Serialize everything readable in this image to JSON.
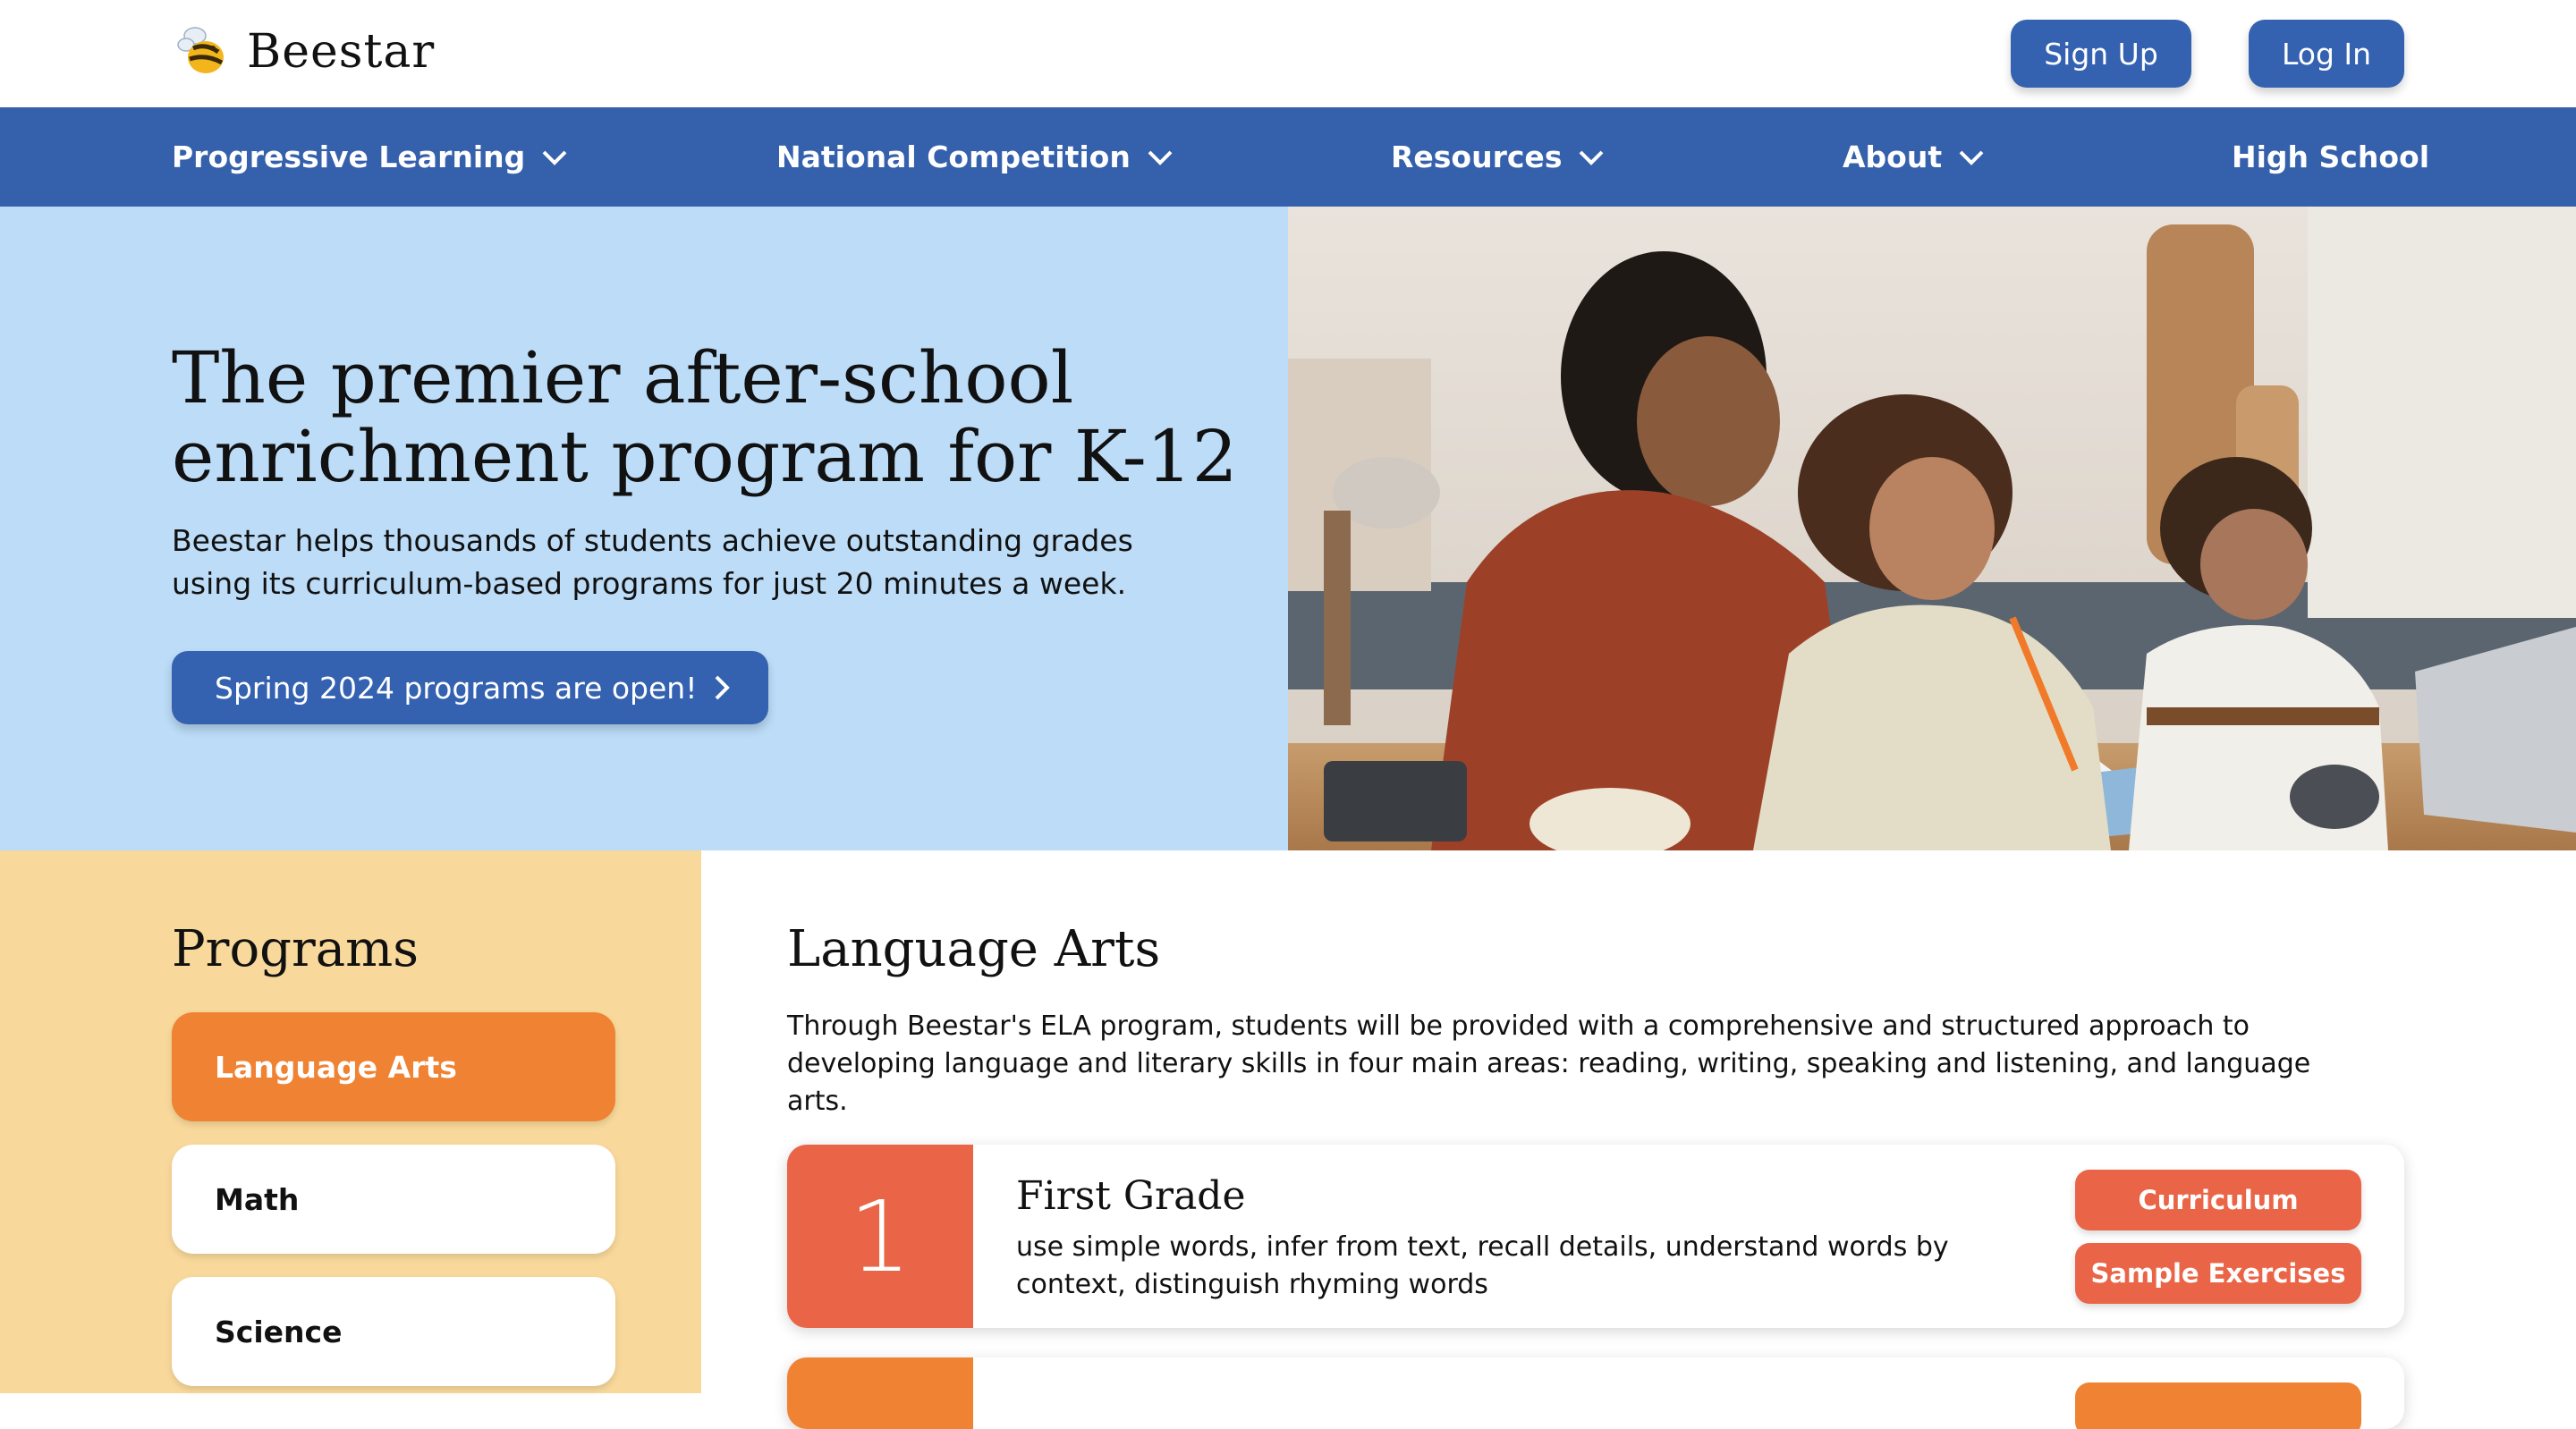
{
  "brand": {
    "name": "Beestar"
  },
  "header": {
    "signup_label": "Sign Up",
    "login_label": "Log In"
  },
  "nav": {
    "items": [
      {
        "label": "Progressive Learning",
        "has_dropdown": true
      },
      {
        "label": "National Competition",
        "has_dropdown": true
      },
      {
        "label": "Resources",
        "has_dropdown": true
      },
      {
        "label": "About",
        "has_dropdown": true
      },
      {
        "label": "High School",
        "has_dropdown": false
      }
    ]
  },
  "hero": {
    "title": "The premier after-school enrichment program for K-12",
    "subtitle": "Beestar helps thousands of students achieve outstanding grades using its curriculum-based programs for just 20 minutes a week.",
    "cta_label": "Spring 2024 programs are open!"
  },
  "programs": {
    "heading": "Programs",
    "items": [
      {
        "label": "Language Arts",
        "active": true
      },
      {
        "label": "Math",
        "active": false
      },
      {
        "label": "Science",
        "active": false
      }
    ]
  },
  "content": {
    "heading": "Language Arts",
    "description": "Through Beestar's ELA program, students will be provided with a comprehensive and structured approach to developing language and literary skills in four main areas: reading, writing, speaking and listening, and language arts.",
    "grades": [
      {
        "number": "1",
        "title": "First Grade",
        "description": "use simple words, infer from text, recall details, understand words by context, distinguish rhyming words",
        "curriculum_label": "Curriculum",
        "samples_label": "Sample Exercises"
      }
    ]
  },
  "colors": {
    "nav_blue": "#3560ab",
    "hero_bg": "#bcdcf7",
    "programs_bg": "#f9d99b",
    "active_orange": "#ef8233",
    "coral": "#ea6547"
  }
}
